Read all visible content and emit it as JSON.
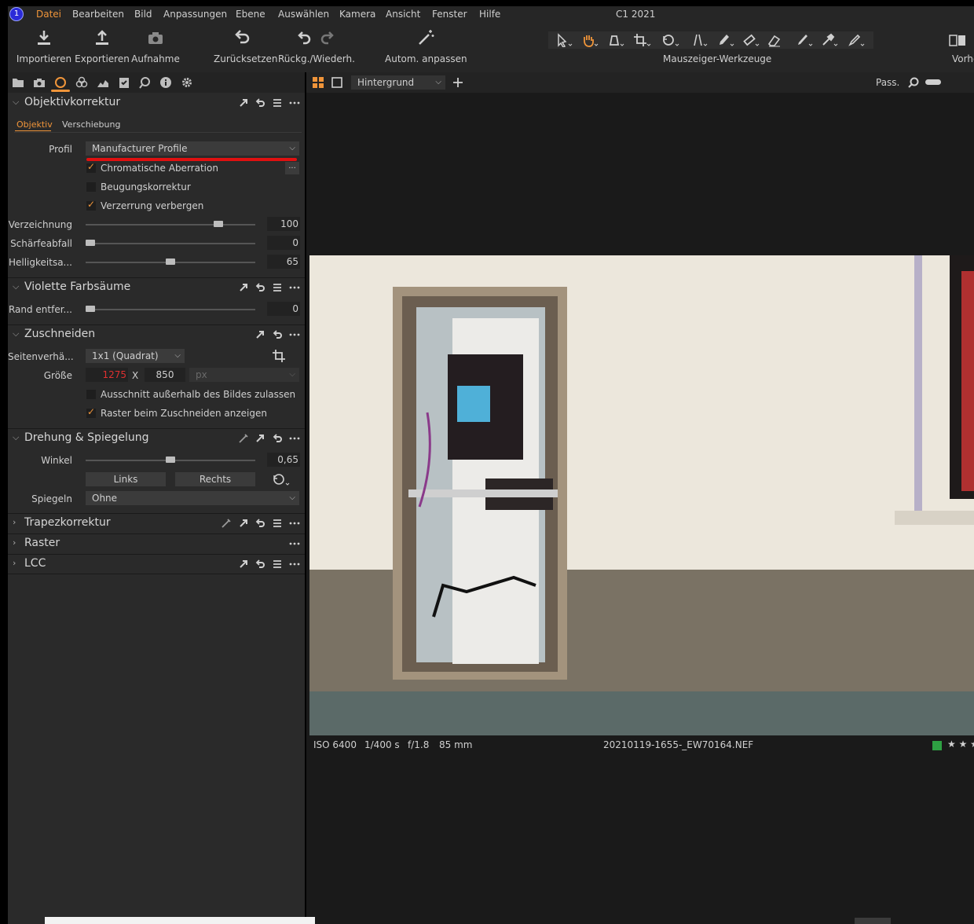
{
  "menubar": {
    "items": [
      "Datei",
      "Bearbeiten",
      "Bild",
      "Anpassungen",
      "Ebene",
      "Auswählen",
      "Kamera",
      "Ansicht",
      "Fenster",
      "Hilfe"
    ],
    "app_version": "C1 2021",
    "logo_text": "1"
  },
  "toolbar": {
    "import_label": "Importieren",
    "export_label": "Exportieren",
    "capture_label": "Aufnahme",
    "reset_label": "Zurücksetzen",
    "undo_redo_label": "Rückg./Wiederh.",
    "auto_adjust_label": "Autom. anpassen",
    "cursor_tools_label": "Mauszeiger-Werkzeuge",
    "preview_label": "Vorhe"
  },
  "viewer": {
    "layer_select": "Hintergrund",
    "fit_label": "Pass."
  },
  "lens_correction": {
    "title": "Objektivkorrektur",
    "tabs": [
      "Objektiv",
      "Verschiebung"
    ],
    "profile_label": "Profil",
    "profile_value": "Manufacturer Profile",
    "chromatic_label": "Chromatische Aberration",
    "diffraction_label": "Beugungskorrektur",
    "hide_distortion_label": "Verzerrung verbergen",
    "more_button": "...",
    "sliders": [
      {
        "label": "Verzeichnung",
        "value": "100",
        "fraction": 0.8
      },
      {
        "label": "Schärfeabfall",
        "value": "0",
        "fraction": 0.0
      },
      {
        "label": "Helligkeitsa...",
        "value": "65",
        "fraction": 0.5
      }
    ]
  },
  "purple_fringing": {
    "title": "Violette Farbsäume",
    "slider": {
      "label": "Rand entfer...",
      "value": "0",
      "fraction": 0.0
    }
  },
  "crop": {
    "title": "Zuschneiden",
    "aspect_label": "Seitenverhä...",
    "aspect_value": "1x1 (Quadrat)",
    "size_label": "Größe",
    "width": "1275",
    "times": "X",
    "height": "850",
    "unit": "px",
    "outside_label": "Ausschnitt außerhalb des Bildes zulassen",
    "grid_label": "Raster beim Zuschneiden anzeigen"
  },
  "rotation": {
    "title": "Drehung & Spiegelung",
    "angle_label": "Winkel",
    "angle_value": "0,65",
    "angle_fraction": 0.5,
    "left_button": "Links",
    "right_button": "Rechts",
    "flip_label": "Spiegeln",
    "flip_value": "Ohne"
  },
  "collapsed_sections": [
    "Trapezkorrektur",
    "Raster",
    "LCC"
  ],
  "meta": {
    "iso": "ISO 6400",
    "shutter": "1/400 s",
    "aperture": "f/1.8",
    "focal": "85 mm",
    "filename": "20210119-1655-_EW70164.NEF",
    "stars": "★ ★ ★",
    "color_tag": "#2ea043"
  },
  "colors": {
    "accent": "#f0953a",
    "panel": "#2a2a2a",
    "viewer": "#1a1a1a",
    "highlight_line": "#e01010",
    "size_red": "#e03030"
  }
}
